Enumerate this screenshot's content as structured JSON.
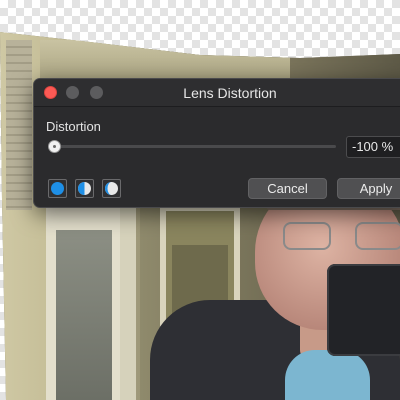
{
  "dialog": {
    "title": "Lens Distortion",
    "distortion_label": "Distortion",
    "distortion_value": "-100 %",
    "distortion_slider": {
      "min": -100,
      "max": 100,
      "value": -100
    },
    "mode_buttons": [
      {
        "icon": "full-circle-icon"
      },
      {
        "icon": "half-circle-icon"
      },
      {
        "icon": "crescent-icon"
      }
    ],
    "cancel_label": "Cancel",
    "apply_label": "Apply"
  },
  "colors": {
    "accent_blue": "#1e8fe6",
    "close_red": "#fc5a55",
    "dialog_bg": "#2b2b2d"
  }
}
